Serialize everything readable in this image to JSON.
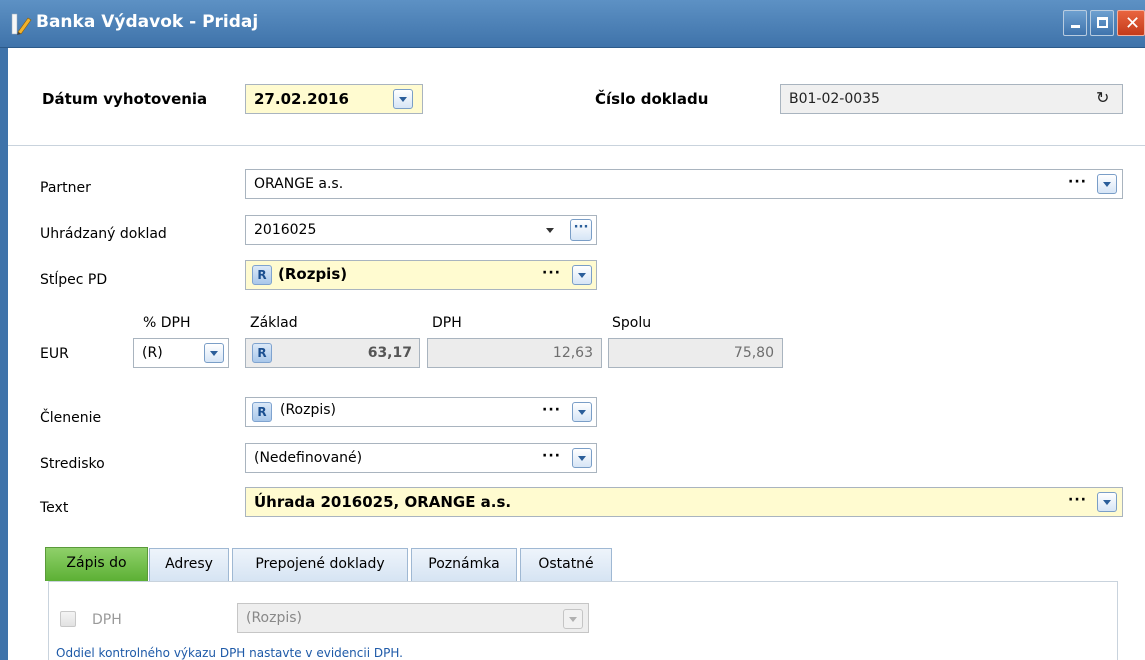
{
  "window": {
    "title": "Banka Výdavok - Pridaj",
    "icon": "pencil-icon",
    "controls": {
      "minimize": "minimize-icon",
      "maximize": "maximize-icon",
      "close": "close-icon"
    }
  },
  "header": {
    "date_label": "Dátum vyhotovenia",
    "date_value": "27.02.2016",
    "doc_number_label": "Číslo dokladu",
    "doc_number_value": "B01-02-0035"
  },
  "form": {
    "partner_label": "Partner",
    "partner_value": "ORANGE a.s.",
    "paid_doc_label": "Uhrádzaný doklad",
    "paid_doc_value": "2016025",
    "column_label": "Stĺpec PD",
    "column_badge": "R",
    "column_value": "(Rozpis)",
    "currency_label": "EUR",
    "vat_pct_label": "% DPH",
    "vat_pct_value": "(R)",
    "base_label": "Základ",
    "base_badge": "R",
    "base_value": "63,17",
    "vat_label": "DPH",
    "vat_value": "12,63",
    "total_label": "Spolu",
    "total_value": "75,80",
    "breakdown_label": "Členenie",
    "breakdown_badge": "R",
    "breakdown_value": "(Rozpis)",
    "center_label": "Stredisko",
    "center_value": "(Nedefinované)",
    "text_label": "Text",
    "text_value": "Úhrada 2016025, ORANGE a.s.",
    "ellipsis": "···"
  },
  "tabs": [
    {
      "label": "Zápis do",
      "active": true
    },
    {
      "label": "Adresy",
      "active": false
    },
    {
      "label": "Prepojené doklady",
      "active": false
    },
    {
      "label": "Poznámka",
      "active": false
    },
    {
      "label": "Ostatné",
      "active": false
    }
  ],
  "tab_content": {
    "dph_checkbox_label": "DPH",
    "dph_checked": false,
    "dph_select_value": "(Rozpis)",
    "note": "Oddiel kontrolného výkazu DPH nastavte v evidencii DPH."
  },
  "colors": {
    "titlebar": "#3f73aa",
    "highlight_field": "#fffbd0",
    "active_tab": "#5cb034",
    "link_text": "#1e5aa8"
  }
}
